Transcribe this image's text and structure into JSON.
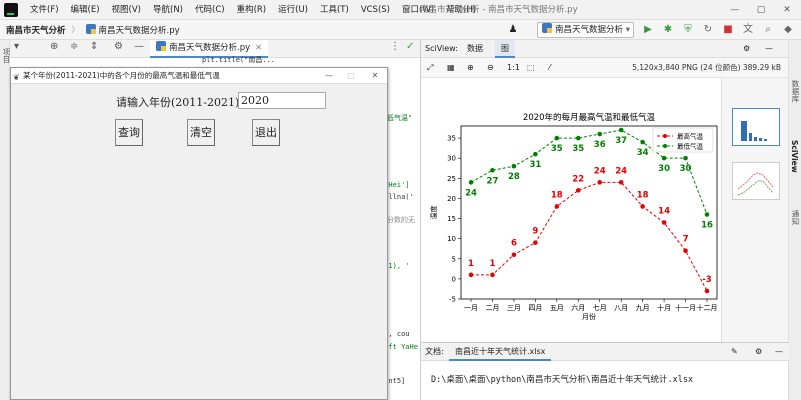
{
  "menubar": {
    "items": [
      "文件(F)",
      "编辑(E)",
      "视图(V)",
      "导航(N)",
      "代码(C)",
      "重构(R)",
      "运行(U)",
      "工具(T)",
      "VCS(S)",
      "窗口(W)",
      "帮助(H)"
    ],
    "window_title": "南昌市天气分析 - 南昌市天气数据分析.py"
  },
  "navbar": {
    "project": "南昌市天气分析",
    "file": "南昌天气数据分析.py",
    "run_config": "南昌天气数据分析"
  },
  "editor": {
    "tab": "南昌天气数据分析.py",
    "project_hint": "南昌市天气分析",
    "project_path": "D:\\桌面\\桌面",
    "code_lines": [
      {
        "top": 55,
        "text": "plt.title(\"南昌..."
      },
      {
        "top": 113,
        "text": "最低气温\""
      },
      {
        "top": 181,
        "text": "YaHei']"
      },
      {
        "top": 193,
        "text": "fillna('"
      },
      {
        "top": 215,
        "text": "度分数的无"
      },
      {
        "top": 262,
        "text": "021), '"
      },
      {
        "top": 330,
        "text": "t4, cou"
      },
      {
        "top": 343,
        "text": "soft YaHe"
      },
      {
        "top": 377,
        "text": "ount5]"
      }
    ]
  },
  "tk_window": {
    "title": "某个年份(2011-2021)中的各个月份的最高气温和最低气温",
    "prompt": "请输入年份(2011-2021):",
    "input_value": "2020",
    "buttons": [
      "查询",
      "清空",
      "退出"
    ]
  },
  "sciview": {
    "label": "SciView:",
    "tabs": [
      "数据",
      "图"
    ],
    "image_info": "5,120x3,840 PNG (24 位颜色) 389.29 kB",
    "zoom": "1:1"
  },
  "right_strip": [
    "数据库",
    "SciView",
    "通知"
  ],
  "doc": {
    "label": "文档:",
    "tab": "南昌近十年天气统计.xlsx",
    "path": "D:\\桌面\\桌面\\python\\南昌市天气分析\\南昌近十年天气统计.xlsx"
  },
  "chart_data": {
    "type": "line",
    "title": "2020年的每月最高气温和最低气温",
    "xlabel": "月份",
    "ylabel": "温度",
    "categories": [
      "一月",
      "二月",
      "三月",
      "四月",
      "五月",
      "六月",
      "七月",
      "八月",
      "九月",
      "十月",
      "十一月",
      "十二月"
    ],
    "ylim": [
      -5,
      38
    ],
    "yticks": [
      -5,
      0,
      5,
      10,
      15,
      20,
      25,
      30,
      35
    ],
    "legend": "top-right",
    "series": [
      {
        "name": "最高气温",
        "color": "#e60000",
        "values": [
          1,
          1,
          6,
          9,
          18,
          22,
          24,
          24,
          18,
          14,
          7,
          -3
        ]
      },
      {
        "name": "最低气温",
        "color": "#008000",
        "values": [
          24,
          27,
          28,
          31,
          35,
          35,
          36,
          37,
          34,
          30,
          30,
          16
        ]
      }
    ]
  },
  "colors": {
    "accent": "#4a88c7",
    "run": "#3a9a3a"
  }
}
